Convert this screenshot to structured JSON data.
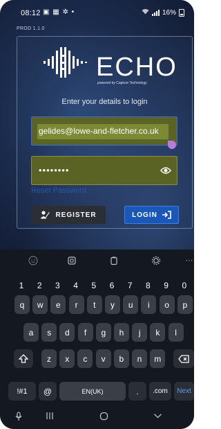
{
  "status_bar": {
    "time": "08:12",
    "notification_icons": "▣ ▦ ✲ •",
    "battery": "16%"
  },
  "app": {
    "build_label": "PROD 1.1.0",
    "logo_text": "ECHO",
    "logo_tagline": "powered by Capture Technology",
    "instruction": "Enter your details to login",
    "email_value": "gelides@lowe-and-fletcher.co.uk",
    "password_value": "••••••••",
    "reset_link": "Reset Password",
    "register_label": "REGISTER",
    "login_label": "LOGIN"
  },
  "keyboard": {
    "language_key": "EN(UK)",
    "symbols_key": "!#1",
    "at_key": "@",
    "period_key": ".",
    "com_key": ".com",
    "next_key": "Next",
    "more_label": "···",
    "number_row": [
      "1",
      "2",
      "3",
      "4",
      "5",
      "6",
      "7",
      "8",
      "9",
      "0"
    ],
    "row1": [
      "q",
      "w",
      "e",
      "r",
      "t",
      "y",
      "u",
      "i",
      "o",
      "p"
    ],
    "row2": [
      "a",
      "s",
      "d",
      "f",
      "g",
      "h",
      "j",
      "k",
      "l"
    ],
    "row3": [
      "z",
      "x",
      "c",
      "v",
      "b",
      "n",
      "m"
    ]
  },
  "colors": {
    "accent": "#1b57b8",
    "field_bg": "#5a6323",
    "link": "#2a56a8",
    "keyboard_bg": "#141821"
  }
}
